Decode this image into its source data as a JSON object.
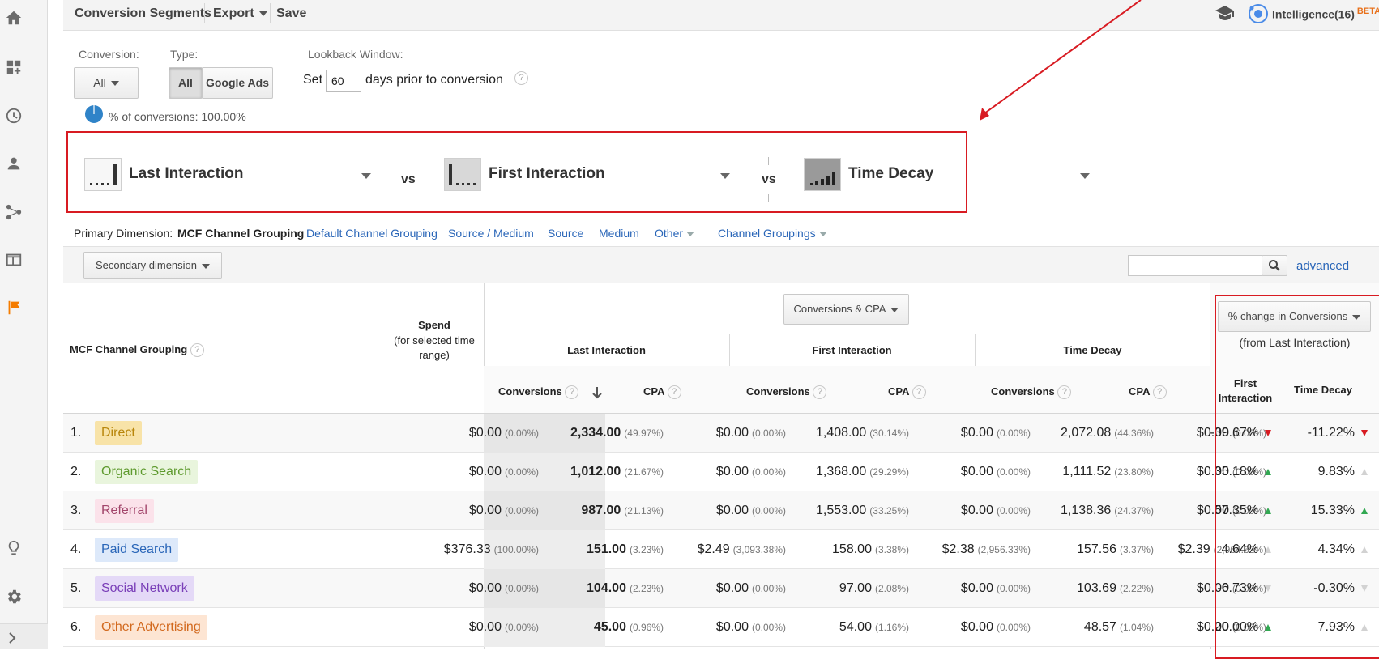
{
  "toolbar": {
    "conversion_segments": "Conversion Segments",
    "export": "Export",
    "save": "Save",
    "intelligence": "Intelligence(16)",
    "beta": "BETA"
  },
  "filters": {
    "conversion_label": "Conversion:",
    "conversion_value": "All",
    "type_label": "Type:",
    "type_all": "All",
    "type_google_ads": "Google Ads",
    "lookback_label": "Lookback Window:",
    "lookback_prefix": "Set",
    "lookback_days": "60",
    "lookback_suffix": "days prior to conversion",
    "pct_conversions": "% of conversions: 100.00%"
  },
  "models": {
    "model1": "Last Interaction",
    "model2": "First Interaction",
    "model3": "Time Decay",
    "vs": "vs"
  },
  "dimensions": {
    "label": "Primary Dimension:",
    "selected": "MCF Channel Grouping",
    "links": [
      "Default Channel Grouping",
      "Source / Medium",
      "Source",
      "Medium",
      "Other",
      "Channel Groupings"
    ],
    "secondary": "Secondary dimension",
    "advanced": "advanced"
  },
  "table": {
    "dim_header": "MCF Channel Grouping",
    "spend_header": "Spend",
    "spend_sub": "(for selected time range)",
    "metric_select": "Conversions & CPA",
    "model_headers": [
      "Last Interaction",
      "First Interaction",
      "Time Decay"
    ],
    "conversions": "Conversions",
    "cpa": "CPA",
    "change_select": "% change in Conversions",
    "change_sub": "(from Last Interaction)",
    "change_first": "First Interaction",
    "change_decay": "Time Decay",
    "rows": [
      {
        "num": "1.",
        "name": "Direct",
        "spend": "$0.00",
        "spend_pct": "(0.00%)",
        "li_conv": "2,334.00",
        "li_conv_pct": "(49.97%)",
        "li_cpa": "$0.00",
        "li_cpa_pct": "(0.00%)",
        "fi_conv": "1,408.00",
        "fi_conv_pct": "(30.14%)",
        "fi_cpa": "$0.00",
        "fi_cpa_pct": "(0.00%)",
        "td_conv": "2,072.08",
        "td_conv_pct": "(44.36%)",
        "td_cpa": "$0.00",
        "td_cpa_pct": "(0.00%)",
        "ch_fi": "-39.67%",
        "ch_td": "-11.22%"
      },
      {
        "num": "2.",
        "name": "Organic Search",
        "spend": "$0.00",
        "spend_pct": "(0.00%)",
        "li_conv": "1,012.00",
        "li_conv_pct": "(21.67%)",
        "li_cpa": "$0.00",
        "li_cpa_pct": "(0.00%)",
        "fi_conv": "1,368.00",
        "fi_conv_pct": "(29.29%)",
        "fi_cpa": "$0.00",
        "fi_cpa_pct": "(0.00%)",
        "td_conv": "1,111.52",
        "td_conv_pct": "(23.80%)",
        "td_cpa": "$0.00",
        "td_cpa_pct": "(0.00%)",
        "ch_fi": "35.18%",
        "ch_td": "9.83%"
      },
      {
        "num": "3.",
        "name": "Referral",
        "spend": "$0.00",
        "spend_pct": "(0.00%)",
        "li_conv": "987.00",
        "li_conv_pct": "(21.13%)",
        "li_cpa": "$0.00",
        "li_cpa_pct": "(0.00%)",
        "fi_conv": "1,553.00",
        "fi_conv_pct": "(33.25%)",
        "fi_cpa": "$0.00",
        "fi_cpa_pct": "(0.00%)",
        "td_conv": "1,138.36",
        "td_conv_pct": "(24.37%)",
        "td_cpa": "$0.00",
        "td_cpa_pct": "(0.00%)",
        "ch_fi": "57.35%",
        "ch_td": "15.33%"
      },
      {
        "num": "4.",
        "name": "Paid Search",
        "spend": "$376.33",
        "spend_pct": "(100.00%)",
        "li_conv": "151.00",
        "li_conv_pct": "(3.23%)",
        "li_cpa": "$2.49",
        "li_cpa_pct": "(3,093.38%)",
        "fi_conv": "158.00",
        "fi_conv_pct": "(3.38%)",
        "fi_cpa": "$2.38",
        "fi_cpa_pct": "(2,956.33%)",
        "td_conv": "157.56",
        "td_conv_pct": "(3.37%)",
        "td_cpa": "$2.39",
        "td_cpa_pct": "(2,964.62%)",
        "ch_fi": "4.64%",
        "ch_td": "4.34%"
      },
      {
        "num": "5.",
        "name": "Social Network",
        "spend": "$0.00",
        "spend_pct": "(0.00%)",
        "li_conv": "104.00",
        "li_conv_pct": "(2.23%)",
        "li_cpa": "$0.00",
        "li_cpa_pct": "(0.00%)",
        "fi_conv": "97.00",
        "fi_conv_pct": "(2.08%)",
        "fi_cpa": "$0.00",
        "fi_cpa_pct": "(0.00%)",
        "td_conv": "103.69",
        "td_conv_pct": "(2.22%)",
        "td_cpa": "$0.00",
        "td_cpa_pct": "(0.00%)",
        "ch_fi": "-6.73%",
        "ch_td": "-0.30%"
      },
      {
        "num": "6.",
        "name": "Other Advertising",
        "spend": "$0.00",
        "spend_pct": "(0.00%)",
        "li_conv": "45.00",
        "li_conv_pct": "(0.96%)",
        "li_cpa": "$0.00",
        "li_cpa_pct": "(0.00%)",
        "fi_conv": "54.00",
        "fi_conv_pct": "(1.16%)",
        "fi_cpa": "$0.00",
        "fi_cpa_pct": "(0.00%)",
        "td_conv": "48.57",
        "td_conv_pct": "(1.04%)",
        "td_cpa": "$0.00",
        "td_cpa_pct": "(0.00%)",
        "ch_fi": "20.00%",
        "ch_td": "7.93%"
      }
    ]
  },
  "channel_colors": {
    "Direct": {
      "bg": "#f8e3a8",
      "fg": "#b8860b"
    },
    "Organic Search": {
      "bg": "#e9f5dd",
      "fg": "#5e9a2e"
    },
    "Referral": {
      "bg": "#fbe2ea",
      "fg": "#a2456b"
    },
    "Paid Search": {
      "bg": "#dde9fa",
      "fg": "#2a66b8"
    },
    "Social Network": {
      "bg": "#e4d9f7",
      "fg": "#7a3fb8"
    },
    "Other Advertising": {
      "bg": "#fde5d3",
      "fg": "#d2691e"
    }
  },
  "arrow_types": [
    [
      "down",
      "down"
    ],
    [
      "up",
      "upg"
    ],
    [
      "up",
      "up"
    ],
    [
      "upg",
      "upg"
    ],
    [
      "downg",
      "downg"
    ],
    [
      "up",
      "upg"
    ]
  ],
  "highlight_color": "#d81b22"
}
